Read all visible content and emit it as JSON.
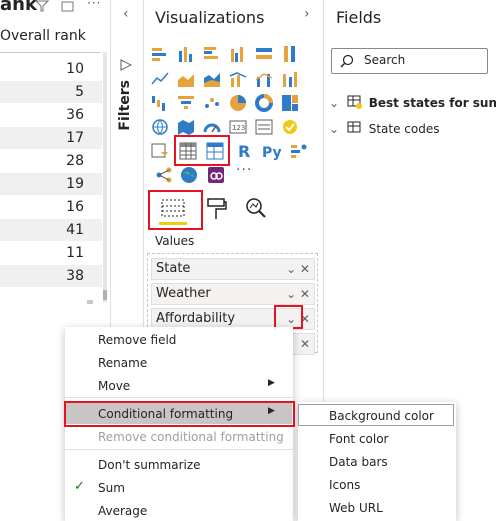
{
  "table": {
    "title": "ank",
    "column_header": "Overall rank",
    "rows": [
      "10",
      "5",
      "36",
      "17",
      "28",
      "19",
      "16",
      "41",
      "11",
      "38"
    ]
  },
  "filters": {
    "label": "Filters"
  },
  "visualizations": {
    "title": "Visualizations",
    "more_label": "···",
    "values_label": "Values",
    "value_fields": [
      {
        "label": "State"
      },
      {
        "label": "Weather"
      },
      {
        "label": "Affordability"
      }
    ]
  },
  "fields": {
    "title": "Fields",
    "search_placeholder": "Search",
    "tables": [
      {
        "label": "Best states for sun..."
      },
      {
        "label": "State codes"
      }
    ]
  },
  "context_menu": {
    "items": [
      {
        "label": "Remove field"
      },
      {
        "label": "Rename"
      },
      {
        "label": "Move"
      },
      {
        "label": "Conditional formatting"
      },
      {
        "label": "Remove conditional formatting"
      },
      {
        "label": "Don't summarize"
      },
      {
        "label": "Sum"
      },
      {
        "label": "Average"
      }
    ],
    "submenu": [
      {
        "label": "Background color"
      },
      {
        "label": "Font color"
      },
      {
        "label": "Data bars"
      },
      {
        "label": "Icons"
      },
      {
        "label": "Web URL"
      }
    ]
  },
  "colors": {
    "highlight_red": "#e81123",
    "accent_yellow": "#f2c811",
    "chart_orange": "#e6a23c",
    "chart_blue": "#2e7cc7"
  }
}
